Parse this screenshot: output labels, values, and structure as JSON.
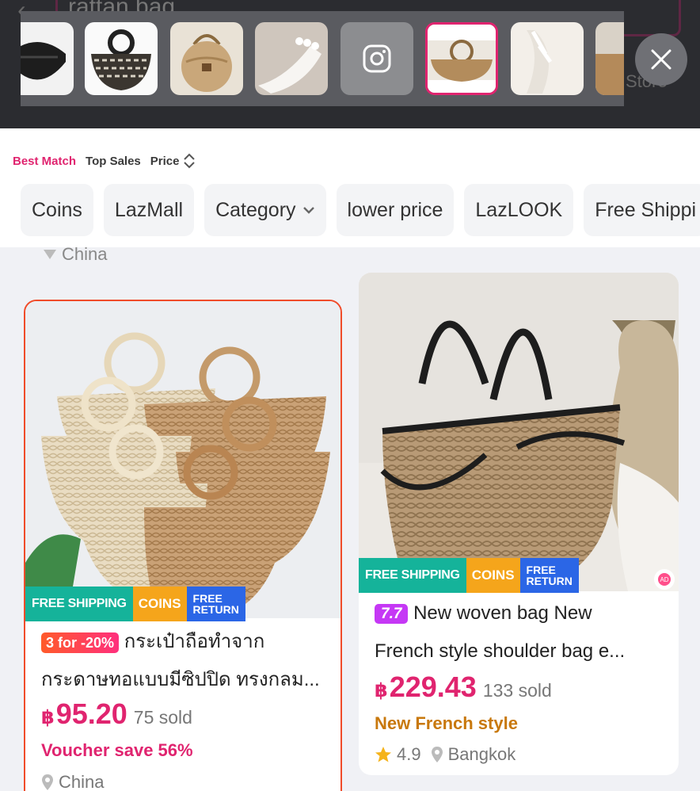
{
  "search": {
    "query": "rattan bag",
    "store_label": "Store"
  },
  "sort": {
    "best_match": "Best Match",
    "top_sales": "Top Sales",
    "price": "Price"
  },
  "chips": [
    "Coins",
    "LazMall",
    "Category",
    "lower price",
    "LazLOOK",
    "Free Shippi"
  ],
  "location_top": "China",
  "badges": {
    "free_shipping": "FREE SHIPPING",
    "coins": "COINS",
    "free_return_1": "FREE",
    "free_return_2": "RETURN"
  },
  "products": [
    {
      "promo": "3 for -20%",
      "title": "กระเป๋าถือทำจากกระดาษทอแบบมีซิปปิด ทรงกลม...",
      "title_line1": "กระเป๋าถือทำจาก",
      "title_line2": "กระดาษทอแบบมีซิปปิด ทรงกลม...",
      "currency": "฿",
      "price": "95.20",
      "sold": "75 sold",
      "voucher": "Voucher save 56%",
      "location": "China"
    },
    {
      "tag": "7.7",
      "title_line1": "New woven bag New",
      "title_line2": "French style shoulder bag e...",
      "currency": "฿",
      "price": "229.43",
      "sold": "133 sold",
      "style": "New French style",
      "rating": "4.9",
      "location": "Bangkok"
    }
  ],
  "colors": {
    "accent": "#e0246f",
    "top_bar": "#2b2c30",
    "free_shipping": "#15b39a",
    "coins": "#f5a51b",
    "free_return": "#2b66e6",
    "style_text": "#c8780c"
  },
  "icons": [
    "back-icon",
    "camera-icon",
    "close-icon",
    "sort-arrows-icon",
    "chevron-down-icon",
    "location-pin-icon",
    "star-icon",
    "ad-icon"
  ]
}
